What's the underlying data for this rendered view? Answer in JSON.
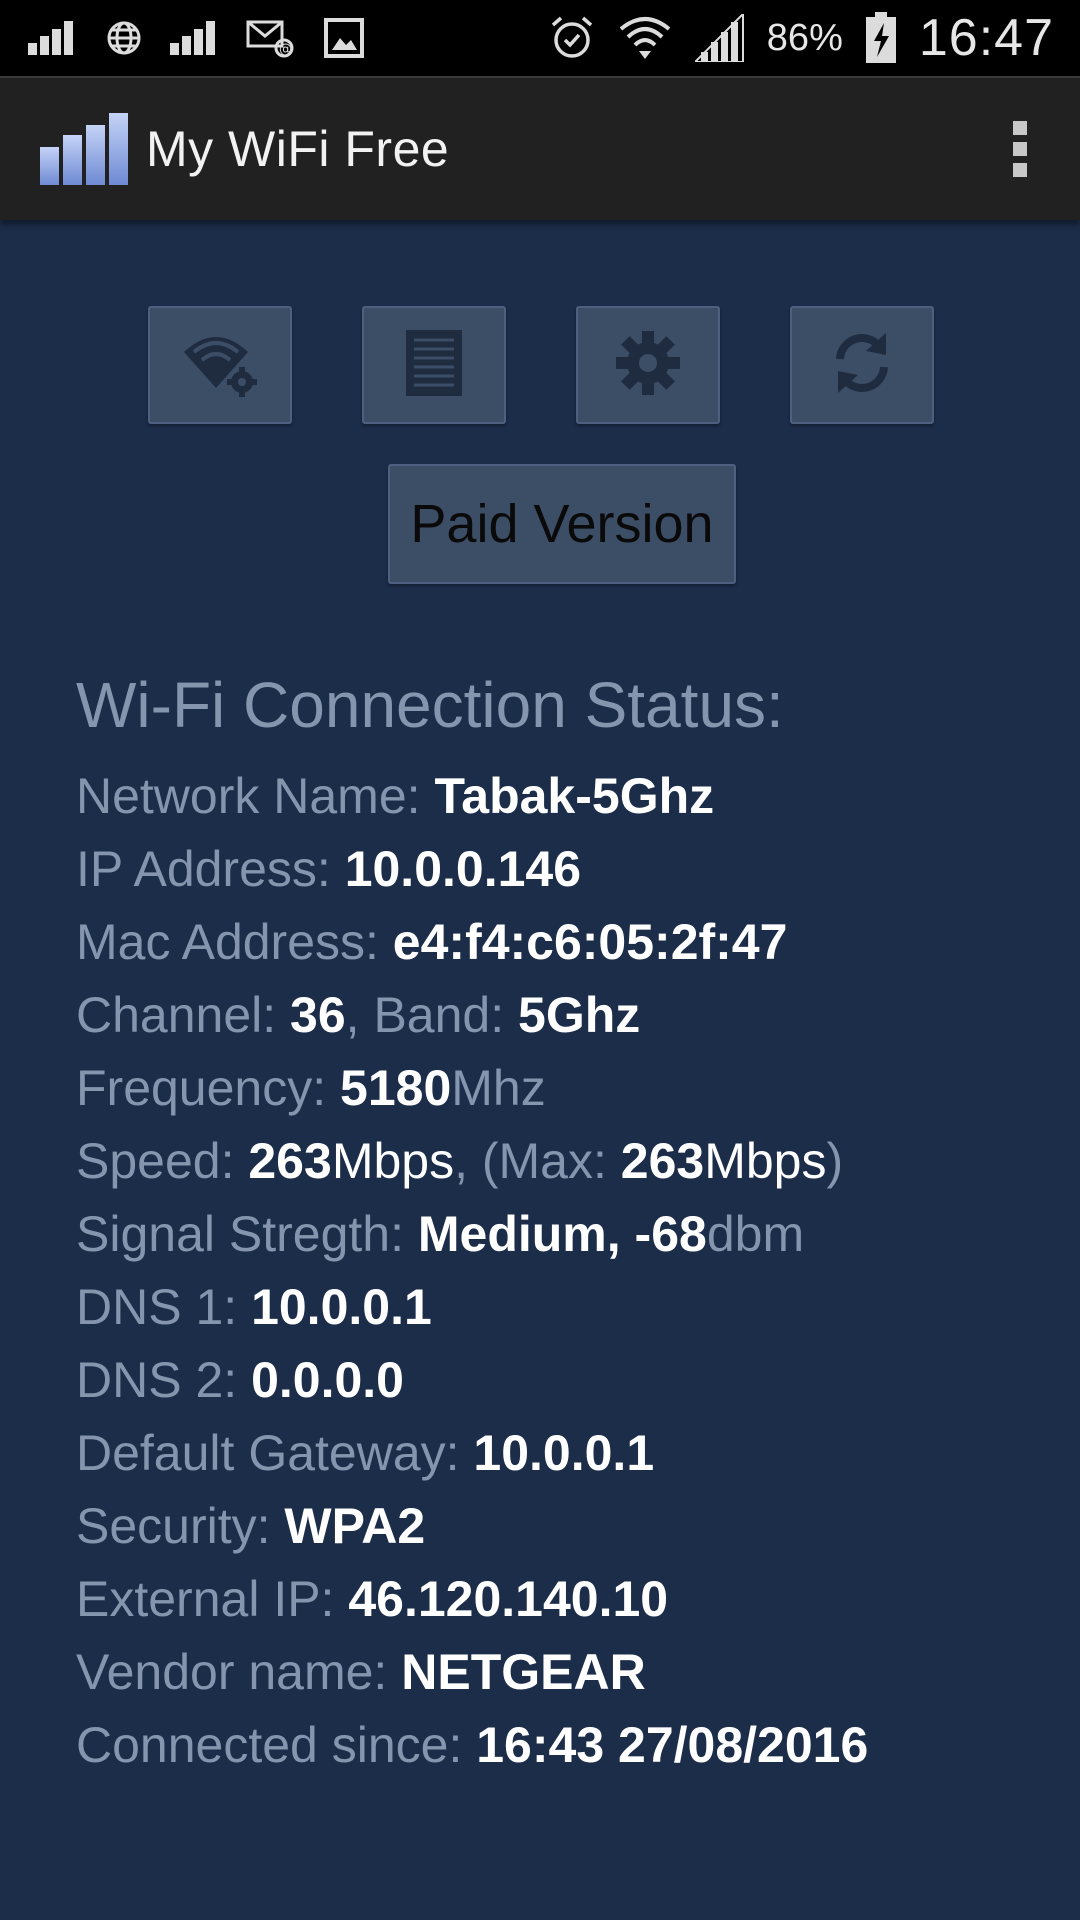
{
  "status_bar": {
    "battery": "86%",
    "time": "16:47",
    "icons": [
      "signal-icon",
      "globe-icon",
      "signal-icon",
      "mail-icon",
      "image-icon",
      "alarm-icon",
      "wifi-icon",
      "signal-icon",
      "battery-icon"
    ]
  },
  "app": {
    "title": "My WiFi Free",
    "logo": "signal-bars-logo",
    "menu_icon": "overflow-menu-icon"
  },
  "toolbar": {
    "buttons": [
      "wifi-settings-icon",
      "list-icon",
      "settings-gear-icon",
      "refresh-icon"
    ],
    "paid_label": "Paid Version"
  },
  "status": {
    "heading": "Wi-Fi Connection Status:",
    "network_label": "Network Name: ",
    "network_value": "Tabak-5Ghz",
    "ip_label": "IP Address: ",
    "ip_value": "10.0.0.146",
    "mac_label": "Mac Address: ",
    "mac_value": "e4:f4:c6:05:2f:47",
    "channel_label": "Channel: ",
    "channel_value": "36",
    "band_label": ", Band: ",
    "band_value": "5Ghz",
    "freq_label": "Frequency: ",
    "freq_value": "5180",
    "freq_unit": "Mhz",
    "speed_label": "Speed: ",
    "speed_value": "263",
    "speed_unit": "Mbps",
    "max_label": ", (Max: ",
    "max_value": "263",
    "max_unit": "Mbps",
    "max_close": ")",
    "signal_label": "Signal Stregth: ",
    "signal_value": "Medium, -68",
    "signal_unit": "dbm",
    "dns1_label": "DNS 1: ",
    "dns1_value": "10.0.0.1",
    "dns2_label": "DNS 2: ",
    "dns2_value": "0.0.0.0",
    "gateway_label": "Default Gateway: ",
    "gateway_value": "10.0.0.1",
    "security_label": "Security: ",
    "security_value": "WPA2",
    "external_label": "External IP: ",
    "external_value": "46.120.140.10",
    "vendor_label": "Vendor name: ",
    "vendor_value": "NETGEAR",
    "since_label": "Connected since: ",
    "since_value": "16:43 27/08/2016"
  },
  "colors": {
    "background": "#1c2d4a",
    "label": "#8595ad",
    "value": "#ffffff",
    "button": "#3c4d66",
    "action_bar": "#212121"
  }
}
